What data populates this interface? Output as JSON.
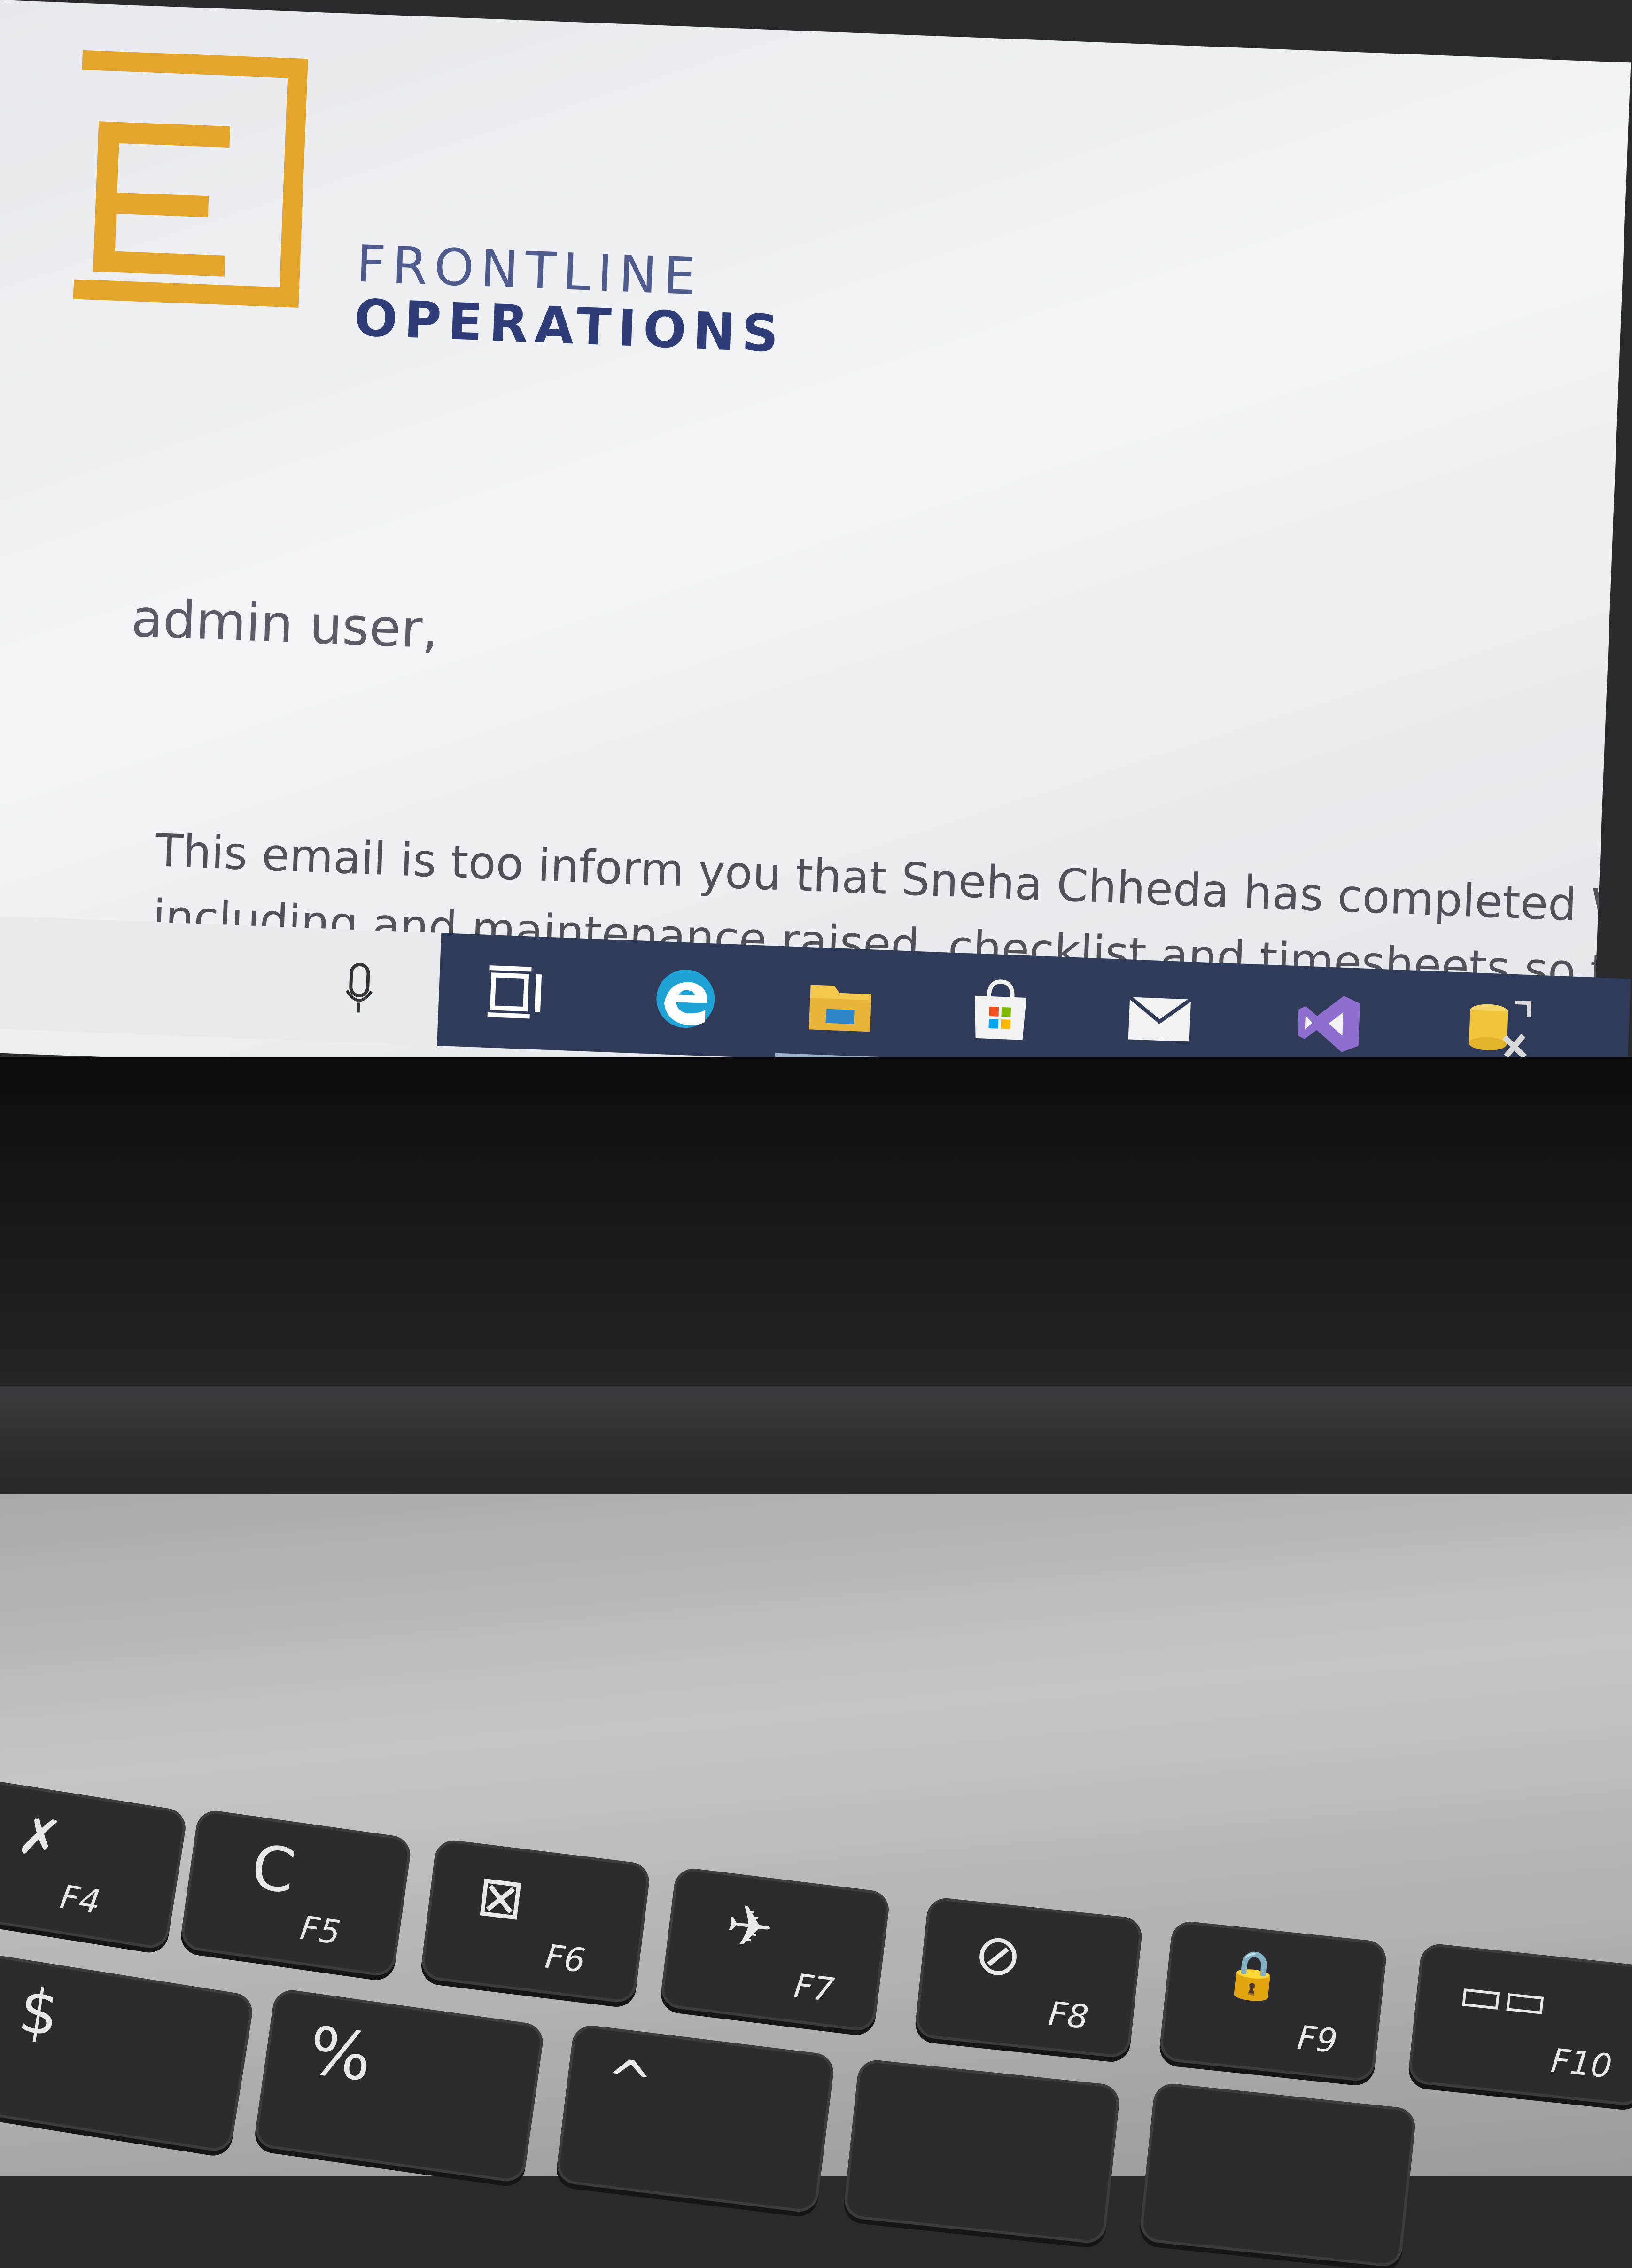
{
  "email": {
    "logo": {
      "line1": "FRONTLINE",
      "line2": "OPERATIONS",
      "brand_color": "#e3a52b"
    },
    "greeting": "admin user,",
    "body_line1": "This email is too inform you that Sneha Chheda has completed WO",
    "body_line2": "including and maintenance raised, checklist and timesheets so the"
  },
  "taskbar": {
    "icons": [
      "microphone-icon",
      "task-view-icon",
      "edge-icon",
      "file-explorer-icon",
      "store-icon",
      "mail-icon",
      "visual-studio-icon",
      "sql-tools-icon"
    ],
    "bar_color": "#2f3b58"
  },
  "keyboard": {
    "function_keys": [
      {
        "label": "F4",
        "symbol": "✗"
      },
      {
        "label": "F5",
        "symbol": "C"
      },
      {
        "label": "F6",
        "symbol": "⊠"
      },
      {
        "label": "F7",
        "symbol": "✈"
      },
      {
        "label": "F8",
        "symbol": "⊘"
      },
      {
        "label": "F9",
        "symbol": "🔒"
      },
      {
        "label": "F10",
        "symbol": "▭▭"
      }
    ],
    "number_row": [
      {
        "symbol": "$"
      },
      {
        "symbol": "%"
      },
      {
        "symbol": "^"
      }
    ]
  }
}
